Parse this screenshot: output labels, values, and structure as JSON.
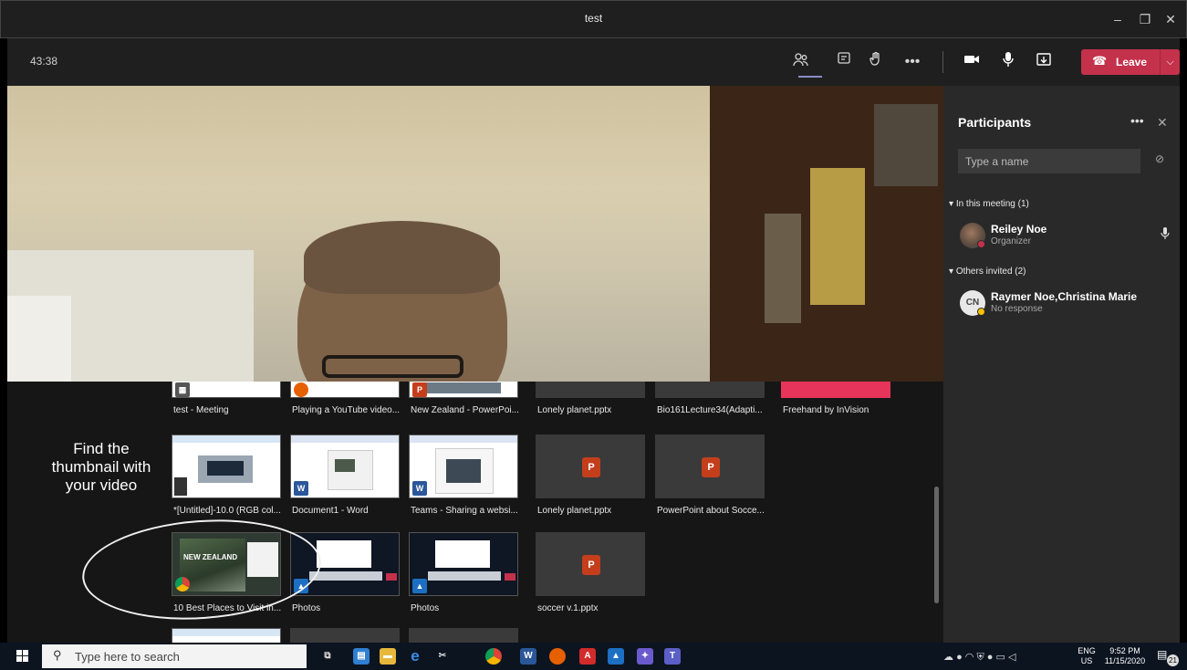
{
  "window": {
    "title": "test"
  },
  "meeting": {
    "timer": "43:38",
    "leave_label": "Leave"
  },
  "share_tray": {
    "hint_lines": [
      "Find the",
      "thumbnail with",
      "your video"
    ],
    "tiles": [
      {
        "label": "test - Meeting"
      },
      {
        "label": "Playing a YouTube video..."
      },
      {
        "label": "New Zealand - PowerPoi..."
      },
      {
        "label": "Lonely planet.pptx"
      },
      {
        "label": "Bio161Lecture34(Adapti..."
      },
      {
        "label": "Freehand by InVision"
      },
      {
        "label": "*[Untitled]-10.0 (RGB col..."
      },
      {
        "label": "Document1 - Word"
      },
      {
        "label": "Teams - Sharing a websi..."
      },
      {
        "label": "Lonely planet.pptx"
      },
      {
        "label": "PowerPoint about Socce..."
      },
      {
        "label": "10 Best Places to Visit in..."
      },
      {
        "label": "Photos"
      },
      {
        "label": "Photos"
      },
      {
        "label": "soccer v.1.pptx"
      }
    ],
    "thumb_texts": {
      "new_zealand": "NEW ZEALAND"
    }
  },
  "participants": {
    "title": "Participants",
    "search_placeholder": "Type a name",
    "in_meeting_label": "In this meeting (1)",
    "others_label": "Others invited (2)",
    "people": [
      {
        "name": "Reiley Noe",
        "role": "Organizer"
      },
      {
        "initials": "CN",
        "name": "Raymer Noe,Christina Marie",
        "role": "No response"
      }
    ]
  },
  "taskbar": {
    "search_placeholder": "Type here to search",
    "lang_top": "ENG",
    "lang_bottom": "US",
    "time": "9:52 PM",
    "date": "11/15/2020",
    "notification_count": "21"
  },
  "colors": {
    "leave": "#c4314b",
    "accent": "#8b8cc7",
    "panel": "#292929"
  }
}
